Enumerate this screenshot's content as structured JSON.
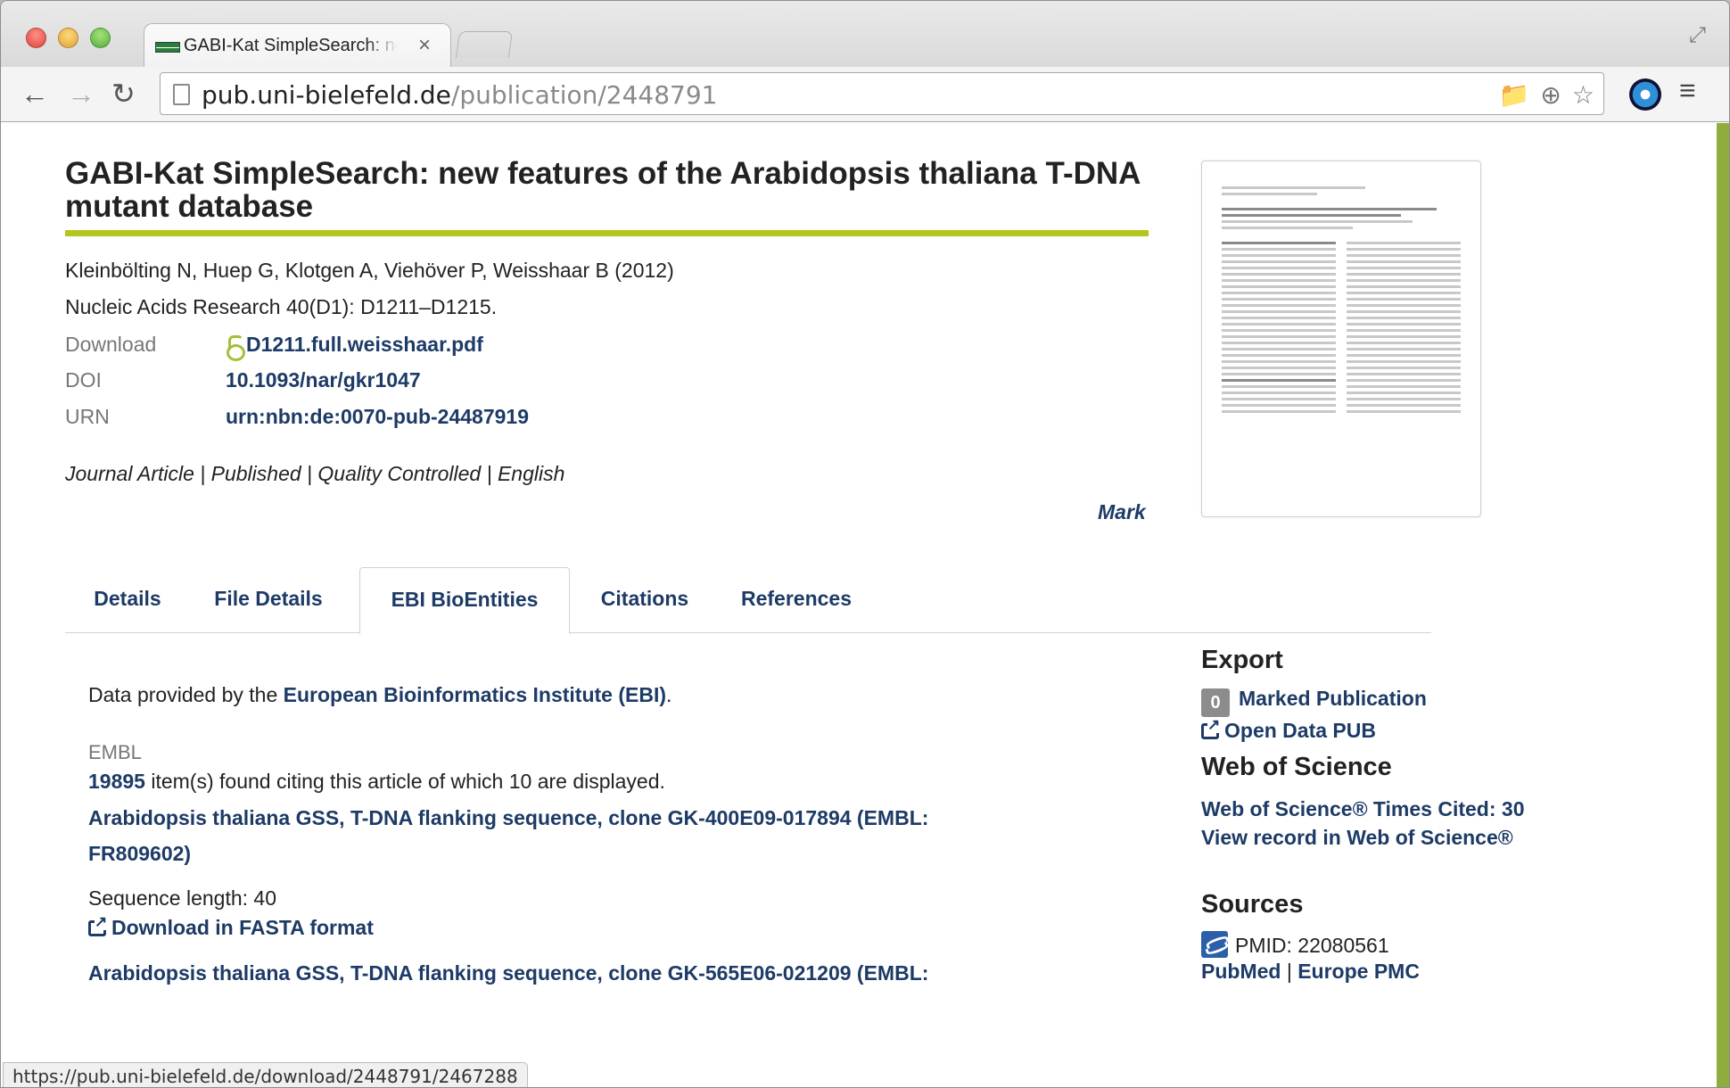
{
  "browser": {
    "tab_title": "GABI-Kat SimpleSearch: ne",
    "tab_close": "×",
    "url_host": "pub.uni-bielefeld.de",
    "url_path": "/publication/2448791",
    "status_url": "https://pub.uni-bielefeld.de/download/2448791/2467288",
    "icons": {
      "back": "←",
      "forward": "→",
      "reload": "↻",
      "folder": "📁",
      "zoom": "⊕",
      "star": "☆",
      "menu": "≡",
      "fullscreen": "⤢"
    }
  },
  "publication": {
    "title": "GABI-Kat SimpleSearch: new features of the Arabidopsis thaliana T-DNA mutant database",
    "authors": "Kleinbölting N, Huep G, Klotgen A, Viehöver P, Weisshaar B (2012)",
    "citation": "Nucleic Acids Research 40(D1): D1211–D1215.",
    "download_label": "Download",
    "download_file": "D1211.full.weisshaar.pdf",
    "doi_label": "DOI",
    "doi_value": "10.1093/nar/gkr1047",
    "urn_label": "URN",
    "urn_value": "urn:nbn:de:0070-pub-24487919",
    "tags": "Journal Article | Published | Quality Controlled | English",
    "mark_label": "Mark"
  },
  "tabs": [
    {
      "label": "Details"
    },
    {
      "label": "File Details"
    },
    {
      "label": "EBI BioEntities"
    },
    {
      "label": "Citations"
    },
    {
      "label": "References"
    }
  ],
  "main": {
    "intro_prefix": "Data provided by the",
    "intro_link": "European Bioinformatics Institute (EBI)",
    "intro_suffix": ".",
    "section_label": "EMBL",
    "count": "19895",
    "count_text": " item(s) found citing this article of which 10 are displayed.",
    "entries": [
      {
        "title": "Arabidopsis thaliana GSS, T-DNA flanking sequence, clone GK-400E09-017894 (EMBL: FR809602)",
        "length": "Sequence length: 40",
        "download": "Download in FASTA format"
      },
      {
        "title": "Arabidopsis thaliana GSS, T-DNA flanking sequence, clone GK-565E06-021209 (EMBL:"
      }
    ]
  },
  "sidebar": {
    "export_heading": "Export",
    "marked_count": "0",
    "marked_label": "Marked Publication",
    "open_data": "Open Data PUB",
    "wos_heading": "Web of Science",
    "wos_cited": "Web of Science® Times Cited: 30",
    "wos_view": "View record in Web of Science®",
    "sources_heading": "Sources",
    "pmid": "PMID: 22080561",
    "pubmed": "PubMed",
    "sep": " | ",
    "europepmc": "Europe PMC"
  }
}
